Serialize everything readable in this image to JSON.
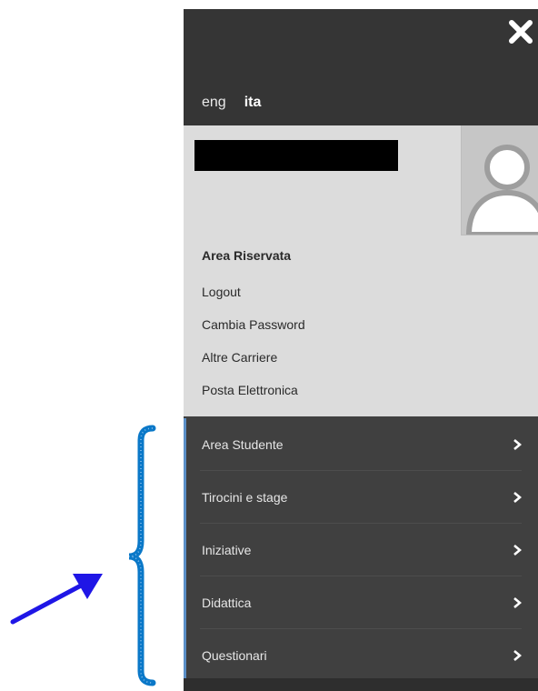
{
  "languages": {
    "eng": "eng",
    "ita": "ita"
  },
  "reserved_area": {
    "title": "Area Riservata",
    "links": [
      "Logout",
      "Cambia Password",
      "Altre Carriere",
      "Posta Elettronica"
    ]
  },
  "nav": {
    "items": [
      "Area Studente",
      "Tirocini e stage",
      "Iniziative",
      "Didattica",
      "Questionari"
    ]
  },
  "icons": {
    "close": "close-icon",
    "avatar": "user-avatar-icon",
    "chevron": "chevron-right-icon"
  },
  "colors": {
    "panel_dark": "#404040",
    "top_bar": "#353535",
    "user_box": "#dcdcdc",
    "annotation_blue": "#0a78c8",
    "arrow_blue": "#1f16e6"
  }
}
